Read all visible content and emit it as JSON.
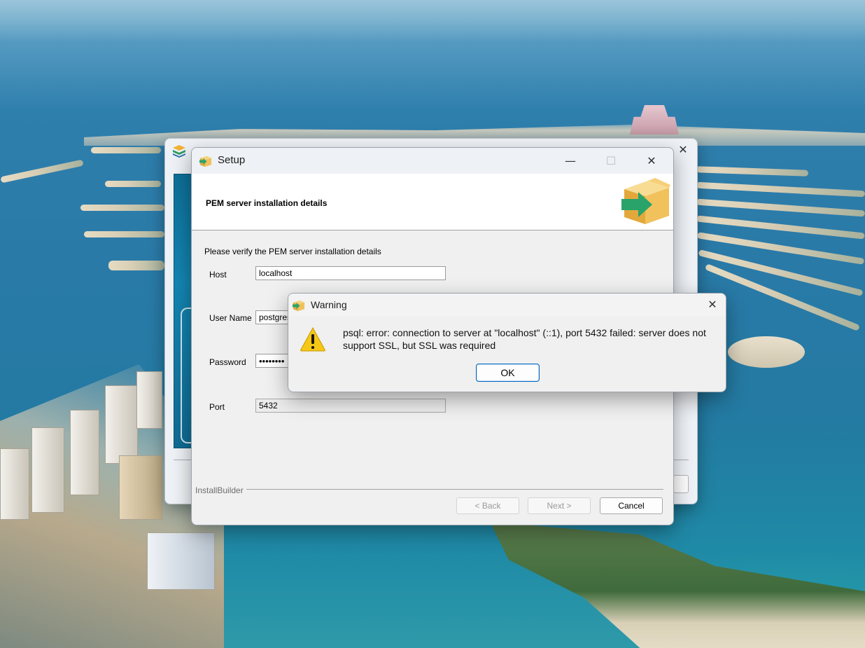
{
  "setup_window": {
    "title": "Setup",
    "heading": "PEM server installation details",
    "instruction": "Please verify the PEM server installation details",
    "fields": {
      "host": {
        "label": "Host",
        "value": "localhost"
      },
      "username": {
        "label": "User Name",
        "value": "postgres"
      },
      "password": {
        "label": "Password",
        "value": "••••••••"
      },
      "port": {
        "label": "Port",
        "value": "5432"
      }
    },
    "footer_brand": "InstallBuilder",
    "buttons": {
      "back": "< Back",
      "next": "Next >",
      "cancel": "Cancel"
    },
    "window_controls": {
      "minimize": "—",
      "maximize": "☐",
      "close": "✕"
    }
  },
  "warning_dialog": {
    "title": "Warning",
    "message": "psql: error: connection to server at \"localhost\" (::1), port 5432 failed: server does not support SSL, but SSL was required",
    "ok_label": "OK",
    "close_symbol": "✕",
    "icon": "warning-triangle-icon"
  },
  "background_window": {
    "close_symbol": "✕"
  },
  "colors": {
    "accent": "#0067c0",
    "warning_icon": "#f7c716",
    "package_box": "#f0c05a",
    "package_arrow": "#2aa36b"
  }
}
